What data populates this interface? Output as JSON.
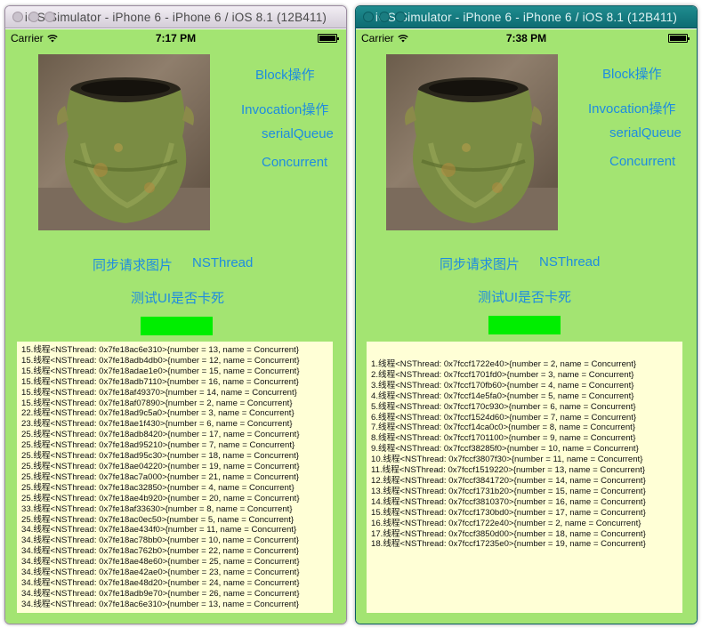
{
  "windows": [
    {
      "title": "iOS Simulator - iPhone 6 - iPhone 6 / iOS 8.1 (12B411)",
      "status": {
        "carrier": "Carrier",
        "time": "7:17 PM"
      },
      "buttons": {
        "block": "Block操作",
        "invocation": "Invocation操作",
        "serial": "serialQueue",
        "concurrent": "Concurrent",
        "sync_image": "同步请求图片",
        "nsthread": "NSThread",
        "test_ui": "测试UI是否卡死"
      },
      "log_lines": [
        "15.线程<NSThread: 0x7fe18ac6e310>{number = 13, name = Concurrent}",
        "15.线程<NSThread: 0x7fe18adb4db0>{number = 12, name = Concurrent}",
        "15.线程<NSThread: 0x7fe18adae1e0>{number = 15, name = Concurrent}",
        "15.线程<NSThread: 0x7fe18adb7110>{number = 16, name = Concurrent}",
        "15.线程<NSThread: 0x7fe18af49370>{number = 14, name = Concurrent}",
        "15.线程<NSThread: 0x7fe18af07890>{number = 2, name = Concurrent}",
        "22.线程<NSThread: 0x7fe18ad9c5a0>{number = 3, name = Concurrent}",
        "23.线程<NSThread: 0x7fe18ae1f430>{number = 6, name = Concurrent}",
        "25.线程<NSThread: 0x7fe18adb8420>{number = 17, name = Concurrent}",
        "25.线程<NSThread: 0x7fe18ad95210>{number = 7, name = Concurrent}",
        "25.线程<NSThread: 0x7fe18ad95c30>{number = 18, name = Concurrent}",
        "25.线程<NSThread: 0x7fe18ae04220>{number = 19, name = Concurrent}",
        "25.线程<NSThread: 0x7fe18ac7a000>{number = 21, name = Concurrent}",
        "25.线程<NSThread: 0x7fe18ac32850>{number = 4, name = Concurrent}",
        "25.线程<NSThread: 0x7fe18ae4b920>{number = 20, name = Concurrent}",
        "33.线程<NSThread: 0x7fe18af33630>{number = 8, name = Concurrent}",
        "25.线程<NSThread: 0x7fe18ac0ec50>{number = 5, name = Concurrent}",
        "34.线程<NSThread: 0x7fe18ae434f0>{number = 11, name = Concurrent}",
        "34.线程<NSThread: 0x7fe18ac78bb0>{number = 10, name = Concurrent}",
        "34.线程<NSThread: 0x7fe18ac762b0>{number = 22, name = Concurrent}",
        "34.线程<NSThread: 0x7fe18ae48e60>{number = 25, name = Concurrent}",
        "34.线程<NSThread: 0x7fe18ae42ae0>{number = 23, name = Concurrent}",
        "34.线程<NSThread: 0x7fe18ae48d20>{number = 24, name = Concurrent}",
        "34.线程<NSThread: 0x7fe18adb9e70>{number = 26, name = Concurrent}",
        "34.线程<NSThread: 0x7fe18ac6e310>{number = 13, name = Concurrent}"
      ]
    },
    {
      "title": "iOS Simulator - iPhone 6 - iPhone 6 / iOS 8.1 (12B411)",
      "status": {
        "carrier": "Carrier",
        "time": "7:38 PM"
      },
      "buttons": {
        "block": "Block操作",
        "invocation": "Invocation操作",
        "serial": "serialQueue",
        "concurrent": "Concurrent",
        "sync_image": "同步请求图片",
        "nsthread": "NSThread",
        "test_ui": "测试UI是否卡死"
      },
      "log_lines": [
        "1.线程<NSThread: 0x7fccf1722e40>{number = 2, name = Concurrent}",
        "2.线程<NSThread: 0x7fccf1701fd0>{number = 3, name = Concurrent}",
        "3.线程<NSThread: 0x7fccf170fb60>{number = 4, name = Concurrent}",
        "4.线程<NSThread: 0x7fccf14e5fa0>{number = 5, name = Concurrent}",
        "5.线程<NSThread: 0x7fccf170c930>{number = 6, name = Concurrent}",
        "6.线程<NSThread: 0x7fccf1524d60>{number = 7, name = Concurrent}",
        "7.线程<NSThread: 0x7fccf14ca0c0>{number = 8, name = Concurrent}",
        "8.线程<NSThread: 0x7fccf1701100>{number = 9, name = Concurrent}",
        "9.线程<NSThread: 0x7fccf38285f0>{number = 10, name = Concurrent}",
        "10.线程<NSThread: 0x7fccf3807f30>{number = 11, name = Concurrent}",
        "11.线程<NSThread: 0x7fccf1519220>{number = 13, name = Concurrent}",
        "12.线程<NSThread: 0x7fccf3841720>{number = 14, name = Concurrent}",
        "13.线程<NSThread: 0x7fccf1731b20>{number = 15, name = Concurrent}",
        "14.线程<NSThread: 0x7fccf3810370>{number = 16, name = Concurrent}",
        "15.线程<NSThread: 0x7fccf1730bd0>{number = 17, name = Concurrent}",
        "16.线程<NSThread: 0x7fccf1722e40>{number = 2, name = Concurrent}",
        "17.线程<NSThread: 0x7fccf3850d00>{number = 18, name = Concurrent}",
        "18.线程<NSThread: 0x7fccf17235e0>{number = 19, name = Concurrent}"
      ]
    }
  ],
  "colors": {
    "screen_background": "#a3e472",
    "button_text": "#1e8ce0",
    "indicator": "#00ee00",
    "log_background": "#ffffd6"
  }
}
